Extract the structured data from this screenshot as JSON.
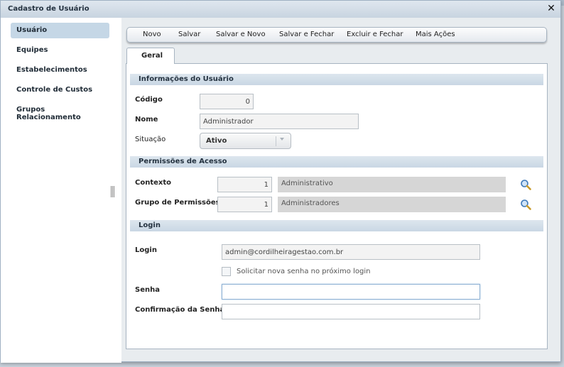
{
  "window": {
    "title": "Cadastro de Usuário"
  },
  "sidebar": {
    "items": [
      {
        "label": "Usuário"
      },
      {
        "label": "Equipes"
      },
      {
        "label": "Estabelecimentos"
      },
      {
        "label": "Controle de Custos"
      },
      {
        "label": "Grupos Relacionamento"
      }
    ]
  },
  "toolbar": {
    "novo": "Novo",
    "salvar": "Salvar",
    "salvar_novo": "Salvar e Novo",
    "salvar_fechar": "Salvar e Fechar",
    "excluir_fechar": "Excluir e Fechar",
    "mais_acoes": "Mais Ações"
  },
  "tabs": {
    "geral": "Geral"
  },
  "info_usuario": {
    "header": "Informações do Usuário",
    "codigo_label": "Código",
    "codigo_value": "0",
    "nome_label": "Nome",
    "nome_value": "Administrador",
    "situacao_label": "Situação",
    "situacao_value": "Ativo"
  },
  "permissoes": {
    "header": "Permissões de Acesso",
    "contexto_label": "Contexto",
    "contexto_code": "1",
    "contexto_desc": "Administrativo",
    "grupo_label": "Grupo de Permissões",
    "grupo_code": "1",
    "grupo_desc": "Administradores"
  },
  "login": {
    "header": "Login",
    "login_label": "Login",
    "login_value": "admin@cordilheiragestao.com.br",
    "nova_senha_label": "Solicitar nova senha no próximo login",
    "nova_senha_checked": false,
    "senha_label": "Senha",
    "senha_value": "",
    "confirmacao_label": "Confirmação da Senha",
    "confirmacao_value": ""
  },
  "colors": {
    "accent": "#c5d7e6",
    "section_header": "#d3dee9"
  }
}
